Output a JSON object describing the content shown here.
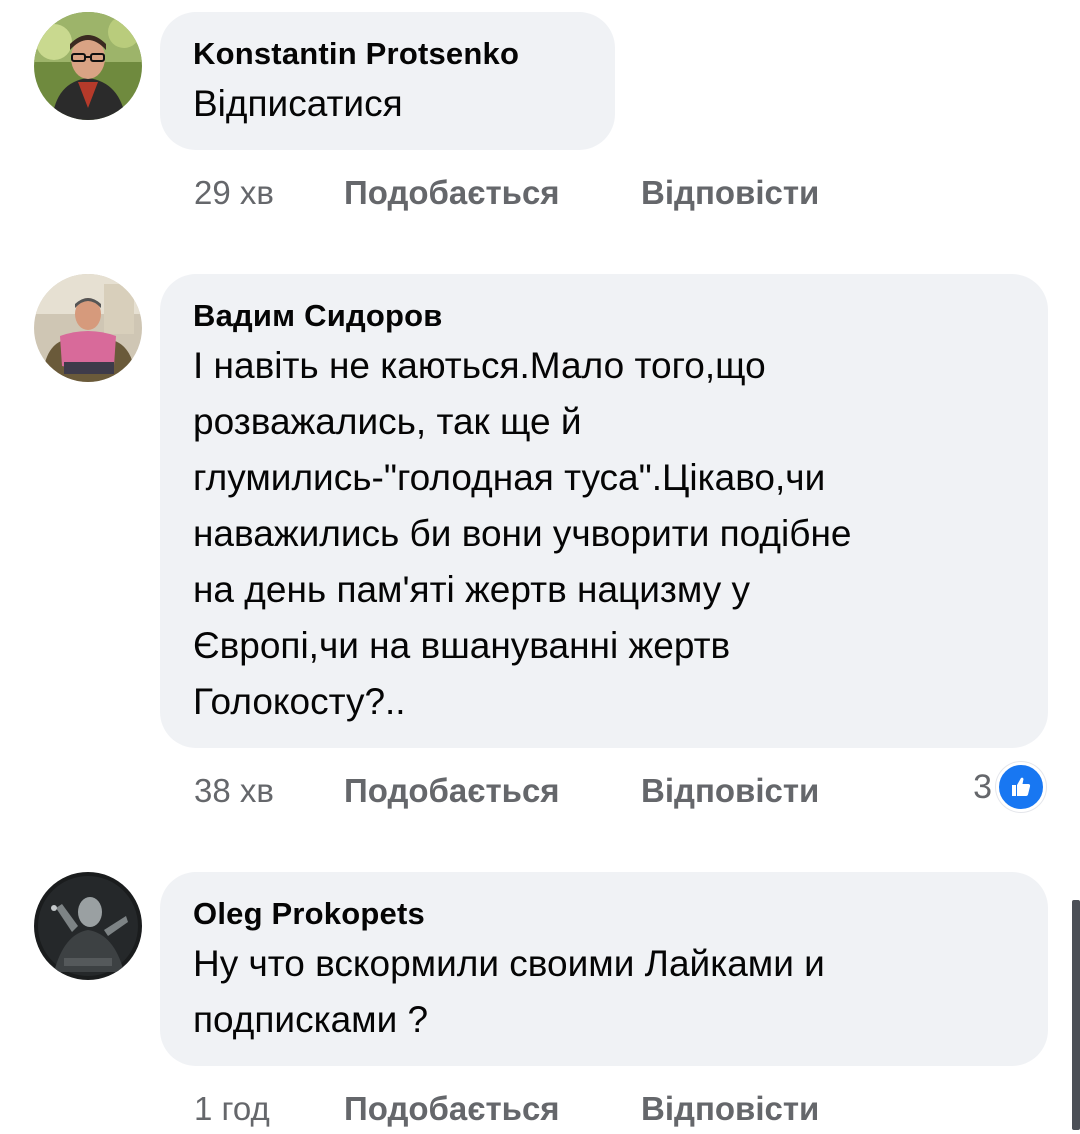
{
  "comments": [
    {
      "author": "Konstantin  Protsenko",
      "text": "Відписатися",
      "time": "29 хв",
      "like_label": "Подобається",
      "reply_label": "Відповісти"
    },
    {
      "author": "Вадим Сидоров",
      "text": "І навіть не каються.Мало того,що\nрозважались, так ще й\nглумились-\"голодная туса\".Цікаво,чи\nнаважились би вони учворити подібне\nна день пам'яті жертв нацизму у\nЄвропі,чи на вшануванні жертв\nГолокосту?..",
      "time": "38 хв",
      "like_label": "Подобається",
      "reply_label": "Відповісти",
      "reaction_count": "3",
      "reaction_icon": "like-thumb-icon"
    },
    {
      "author": "Oleg Prokopets",
      "text": "Ну что вскормили своими Лайками и\nподписками ?",
      "time": "1 год",
      "like_label": "Подобається",
      "reply_label": "Відповісти"
    }
  ],
  "colors": {
    "bubble": "#f0f2f5",
    "meta_text": "#65676b",
    "like_blue": "#1877f2"
  }
}
